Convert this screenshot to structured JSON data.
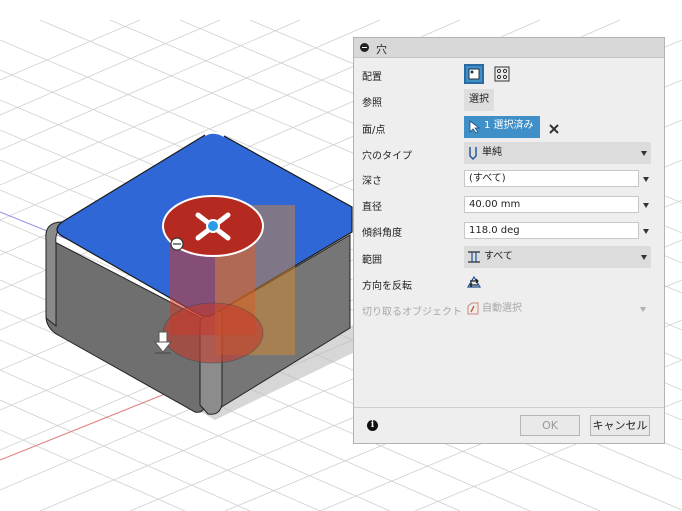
{
  "dialog": {
    "title": "穴",
    "rows": {
      "placement": {
        "label": "配置"
      },
      "reference": {
        "label": "参照",
        "button": "選択"
      },
      "face_point": {
        "label": "面/点",
        "button": "1 選択済み"
      },
      "hole_type": {
        "label": "穴のタイプ",
        "value": "単純"
      },
      "depth": {
        "label": "深さ",
        "value": "(すべて)"
      },
      "diameter": {
        "label": "直径",
        "value": "40.00 mm"
      },
      "tip_angle": {
        "label": "傾斜角度",
        "value": "118.0 deg"
      },
      "extent": {
        "label": "範囲",
        "value": "すべて"
      },
      "flip": {
        "label": "方向を反転"
      },
      "objects_to_cut": {
        "label": "切り取るオブジェクト",
        "value": "自動選択"
      }
    },
    "footer": {
      "ok": "OK",
      "cancel": "キャンセル",
      "info": "i"
    }
  },
  "colors": {
    "accent": "#3f8fc9",
    "face_blue": "#2f67d6",
    "hole_red": "#b52a20",
    "body_gray": "#707070"
  },
  "icons": [
    "collapse-icon",
    "single-hole-icon",
    "multiple-holes-icon",
    "cursor-arrow-icon",
    "clear-x-icon",
    "simple-hole-icon",
    "extent-all-icon",
    "flip-direction-icon",
    "auto-select-icon",
    "info-icon",
    "move-manipulator-icon",
    "anchor-icon"
  ]
}
